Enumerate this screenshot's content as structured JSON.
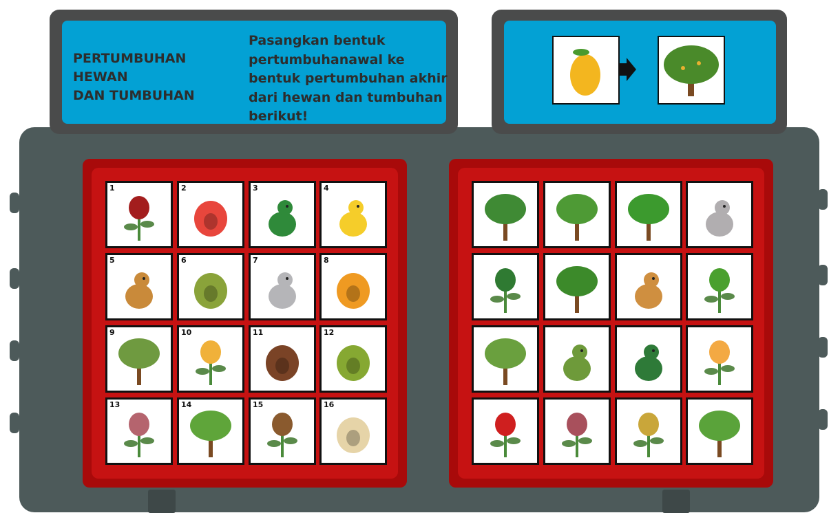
{
  "header": {
    "title": "PERTUMBUHAN HEWAN\nDAN TUMBUHAN",
    "instruction": "Pasangkan bentuk pertumbuhanawal ke bentuk pertumbuhan akhir dari hewan dan tumbuhan berikut!"
  },
  "example": {
    "from_icon": "mango-fruit-icon",
    "arrow_icon": "arrow-right-icon",
    "to_icon": "mango-tree-icon"
  },
  "colors": {
    "board": "#4d5a5a",
    "panel": "#03a1d4",
    "red": "#c61212"
  },
  "left_cards": [
    {
      "num": "1",
      "icon": "rose-bud-icon",
      "c": "#a31d1d"
    },
    {
      "num": "2",
      "icon": "watermelon-slice-icon",
      "c": "#e8463c"
    },
    {
      "num": "3",
      "icon": "tadpole-icon",
      "c": "#2f8a3a"
    },
    {
      "num": "4",
      "icon": "duckling-icon",
      "c": "#f5cd2a"
    },
    {
      "num": "5",
      "icon": "joey-kangaroo-icon",
      "c": "#c98a3a"
    },
    {
      "num": "6",
      "icon": "avocado-icon",
      "c": "#8aa33a"
    },
    {
      "num": "7",
      "icon": "baby-rabbit-icon",
      "c": "#b5b5b8"
    },
    {
      "num": "8",
      "icon": "papaya-icon",
      "c": "#ef9a22"
    },
    {
      "num": "9",
      "icon": "bamboo-shoot-icon",
      "c": "#6f9a40"
    },
    {
      "num": "10",
      "icon": "hibiscus-bud-icon",
      "c": "#f0b13a"
    },
    {
      "num": "11",
      "icon": "salak-fruit-icon",
      "c": "#7a4326"
    },
    {
      "num": "12",
      "icon": "green-beans-icon",
      "c": "#86a832"
    },
    {
      "num": "13",
      "icon": "shallot-icon",
      "c": "#b5646e"
    },
    {
      "num": "14",
      "icon": "banana-sprout-icon",
      "c": "#5fa53a"
    },
    {
      "num": "15",
      "icon": "sprouting-coconut-icon",
      "c": "#8a5a2e"
    },
    {
      "num": "16",
      "icon": "rice-grain-icon",
      "c": "#e6d4a8"
    }
  ],
  "right_cards": [
    {
      "icon": "oil-palm-tree-icon",
      "c": "#3f8a34"
    },
    {
      "icon": "papaya-tree-icon",
      "c": "#4e9a35"
    },
    {
      "icon": "coconut-tree-icon",
      "c": "#3c9a2e"
    },
    {
      "icon": "rabbit-icon",
      "c": "#b1aeb0"
    },
    {
      "icon": "watermelon-plant-icon",
      "c": "#2f7a32"
    },
    {
      "icon": "avocado-tree-icon",
      "c": "#3c8a2a"
    },
    {
      "icon": "kangaroo-icon",
      "c": "#cf8f40"
    },
    {
      "icon": "bean-sprout-icon",
      "c": "#4aa02e"
    },
    {
      "icon": "banana-tree-icon",
      "c": "#6aa03e"
    },
    {
      "icon": "frog-icon",
      "c": "#6e9a3a"
    },
    {
      "icon": "duck-icon",
      "c": "#2e7a38"
    },
    {
      "icon": "hibiscus-flower-icon",
      "c": "#f3a943"
    },
    {
      "icon": "rose-icon",
      "c": "#cf1f1f"
    },
    {
      "icon": "shallot-plant-icon",
      "c": "#a8505c"
    },
    {
      "icon": "rice-plant-icon",
      "c": "#c9a63a"
    },
    {
      "icon": "bamboo-icon",
      "c": "#5aa33a"
    }
  ]
}
